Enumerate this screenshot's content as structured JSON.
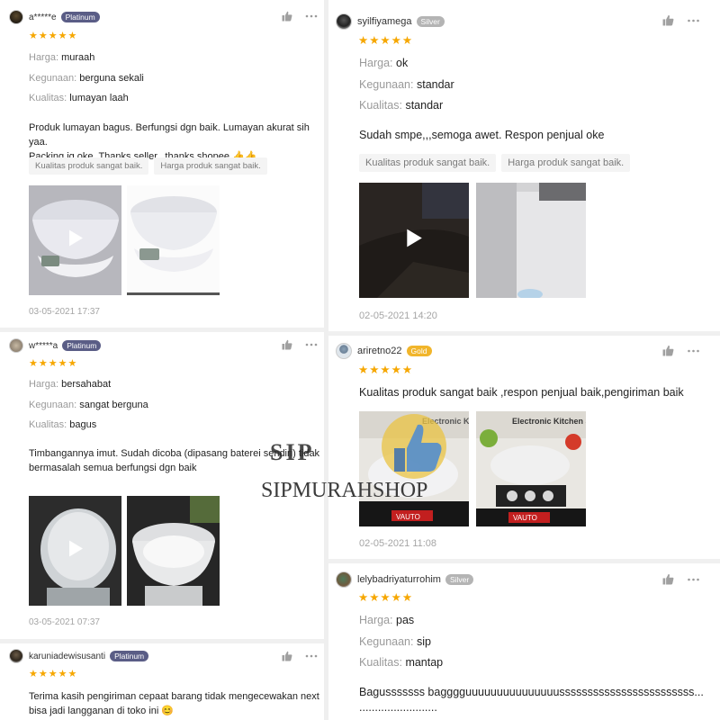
{
  "reviews_left": [
    {
      "username": "a*****e",
      "badge": "Platinum",
      "stars": "★★★★★",
      "attrs": [
        {
          "k": "Harga:",
          "v": "muraah"
        },
        {
          "k": "Kegunaan:",
          "v": "berguna sekali"
        },
        {
          "k": "Kualitas:",
          "v": "lumayan laah"
        }
      ],
      "comment_line1": "Produk lumayan bagus. Berfungsi dgn baik. Lumayan akurat sih yaa.",
      "comment_line2": "Packing jg oke. Thanks seller.. thanks shopee 👍👍",
      "tags": [
        "Kualitas produk sangat baik.",
        "Harga produk sangat baik."
      ],
      "date": "03-05-2021 17:37"
    },
    {
      "username": "w*****a",
      "badge": "Platinum",
      "stars": "★★★★★",
      "attrs": [
        {
          "k": "Harga:",
          "v": "bersahabat"
        },
        {
          "k": "Kegunaan:",
          "v": "sangat berguna"
        },
        {
          "k": "Kualitas:",
          "v": "bagus"
        }
      ],
      "comment_line1": "Timbangannya imut. Sudah dicoba (dipasang baterei sendiri) tidak",
      "comment_line2": "bermasalah semua berfungsi dgn baik",
      "date": "03-05-2021 07:37"
    },
    {
      "username": "karuniadewisusanti",
      "badge": "Platinum",
      "stars": "★★★★★",
      "comment_line1": "Terima kasih pengiriman cepaat barang tidak mengecewakan next",
      "comment_line2": "bisa jadi langganan di toko ini 😊"
    }
  ],
  "reviews_right": [
    {
      "username": "syilfiyamega",
      "badge": "Silver",
      "stars": "★★★★★",
      "attrs": [
        {
          "k": "Harga:",
          "v": "ok"
        },
        {
          "k": "Kegunaan:",
          "v": "standar"
        },
        {
          "k": "Kualitas:",
          "v": "standar"
        }
      ],
      "comment": "Sudah smpe,,,semoga awet. Respon penjual oke",
      "tags": [
        "Kualitas produk sangat baik.",
        "Harga produk sangat baik."
      ],
      "date": "02-05-2021 14:20"
    },
    {
      "username": "ariretno22",
      "badge": "Gold",
      "stars": "★★★★★",
      "comment": "Kualitas produk sangat baik ,respon penjual baik,pengiriman baik",
      "box_text": "VAUTO",
      "box_label": "Electronic Kitchen Scale",
      "date": "02-05-2021 11:08"
    },
    {
      "username": "lelybadriyaturrohim",
      "badge": "Silver",
      "stars": "★★★★★",
      "attrs": [
        {
          "k": "Harga:",
          "v": "pas"
        },
        {
          "k": "Kegunaan:",
          "v": "sip"
        },
        {
          "k": "Kualitas:",
          "v": "mantap"
        }
      ],
      "comment_line1": "Bagusssssss bagggguuuuuuuuuuuuuuussssssssssssssssssssssss...",
      "comment_line2": "........................."
    }
  ],
  "watermark": {
    "sip": "SIP",
    "shop": "SIPMURAHSHOP"
  },
  "colors": {
    "star": "#f6a700",
    "platinum": "#5a5d86",
    "silver": "#b4b4b4",
    "gold": "#f1b52b"
  }
}
